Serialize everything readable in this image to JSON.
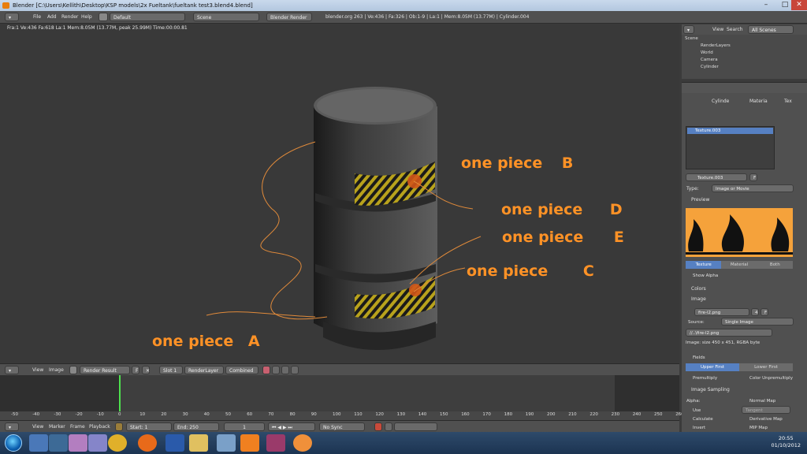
{
  "window": {
    "title": "Blender [C:\\Users\\Kellith\\Desktop\\KSP models\\2x Fueltank\\fueltank test3.blend4.blend]",
    "min": "–",
    "max": "□",
    "close": "✕"
  },
  "info_header": {
    "menus": [
      "File",
      "Add",
      "Render",
      "Help"
    ],
    "layout": "Default",
    "scene": "Scene",
    "engine": "Blender Render",
    "stats": "blender.org 263 | Ve:436 | Fa:326 | Ob:1-9 | La:1 | Mem:8.05M (13.77M) | Cylinder.004"
  },
  "viewport": {
    "info": "Fra:1  Ve:436 Fa:618 La:1 Mem:8.05M (13.77M, peak 25.99M) Time:00:00.81"
  },
  "annotations": [
    {
      "text": "one piece",
      "letter": "B"
    },
    {
      "text": "one piece",
      "letter": "D"
    },
    {
      "text": "one piece",
      "letter": "E"
    },
    {
      "text": "one piece",
      "letter": "C"
    },
    {
      "text": "one piece",
      "letter": "A"
    }
  ],
  "image_header": {
    "menus": [
      "View",
      "Image"
    ],
    "image_name": "Render Result",
    "f": "F",
    "slot": "Slot 1",
    "layer": "RenderLayer",
    "pass": "Combined"
  },
  "ruler": [
    "-50",
    "-40",
    "-30",
    "-20",
    "-10",
    "0",
    "10",
    "20",
    "30",
    "40",
    "50",
    "60",
    "70",
    "80",
    "90",
    "100",
    "110",
    "120",
    "130",
    "140",
    "150",
    "160",
    "170",
    "180",
    "190",
    "200",
    "210",
    "220",
    "230",
    "240",
    "250",
    "260",
    "270",
    "280"
  ],
  "timeline_header": {
    "menus": [
      "View",
      "Marker",
      "Frame",
      "Playback"
    ],
    "start": "Start: 1",
    "end": "End: 250",
    "current": "1",
    "sync": "No Sync"
  },
  "outliner": {
    "header": [
      "View",
      "Search",
      "All Scenes"
    ],
    "rows": [
      "Scene",
      "RenderLayers",
      "World",
      "Camera",
      "Cylinder"
    ]
  },
  "properties": {
    "breadcrumb": [
      "Cylinde",
      "Materia",
      "Tex"
    ],
    "texture_slot": "Texture.003",
    "texture_name": "Texture.003",
    "texture_f": "F",
    "type_label": "Type:",
    "type_value": "Image or Movie",
    "preview_label": "Preview",
    "preview_tabs": [
      "Texture",
      "Material",
      "Both"
    ],
    "show_alpha": "Show Alpha",
    "colors": "Colors",
    "image_panel": "Image",
    "image_name": "fire-l2.png",
    "image_users": "4",
    "image_f": "F",
    "source_label": "Source:",
    "source_value": "Single Image",
    "filepath": "//..\\fire-l2.png",
    "image_info": "Image: size 450 x 451, RGBA byte",
    "fields": "Fields",
    "field_tabs": [
      "Upper First",
      "Lower First"
    ],
    "premultiply": "Premultiply",
    "color_unpremultiply": "Color Unpremultiply",
    "image_sampling": "Image Sampling",
    "alpha_label": "Alpha:",
    "normal_map": "Normal Map",
    "use": "Use",
    "tangent": "Tangent",
    "calculate": "Calculate",
    "derivative_map": "Derivative Map",
    "invert": "Invert",
    "mip_map": "MIP Map"
  },
  "clock": {
    "time": "20:55",
    "date": "01/10/2012"
  },
  "colors": {
    "annotation": "#ff9226",
    "accent": "#5680c2"
  }
}
